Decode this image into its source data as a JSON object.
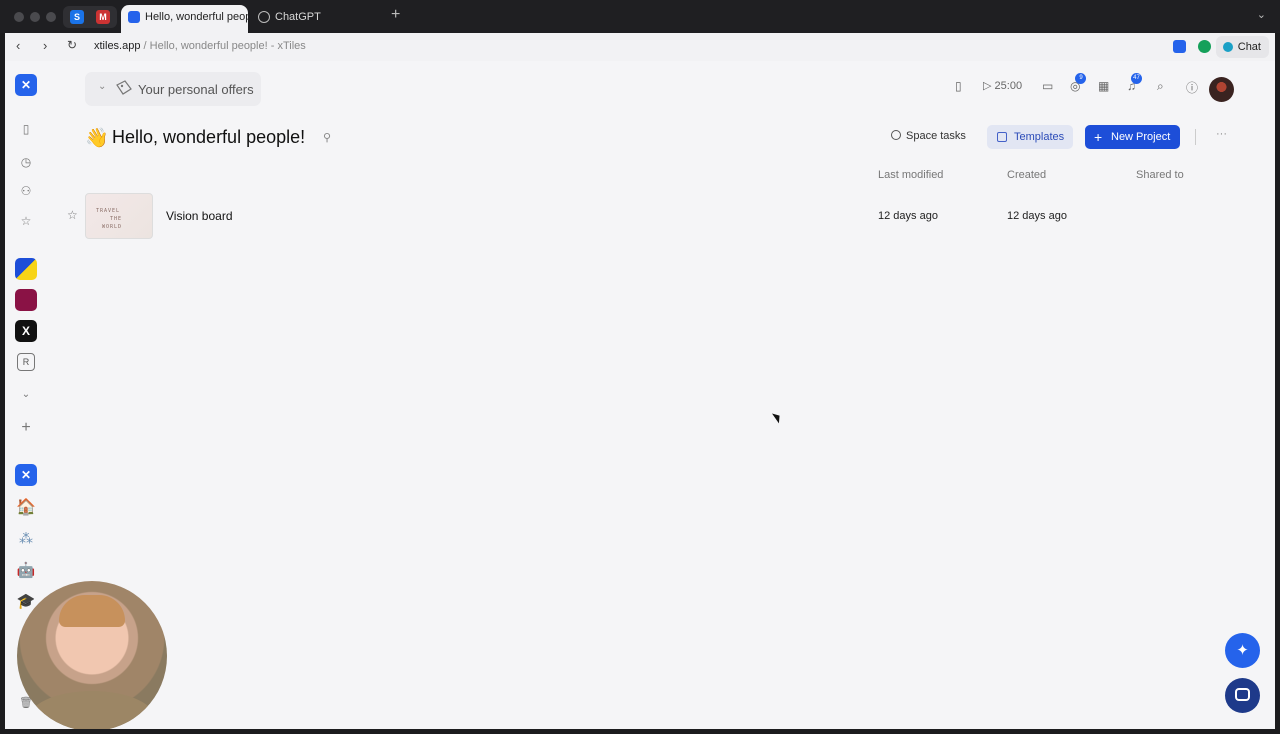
{
  "browser": {
    "tabs": [
      {
        "label": "Hello, wonderful peopl",
        "active": true
      },
      {
        "label": "ChatGPT",
        "active": false
      }
    ],
    "url_host": "xtiles.app",
    "url_rest": " / Hello, wonderful people! - xTiles",
    "chat_label": "Chat"
  },
  "rail": {
    "workspace_letter": "R"
  },
  "header": {
    "offers_label": "Your personal offers",
    "timer": "25:00",
    "tasks_badge": "9",
    "notifications_badge": "47"
  },
  "page": {
    "emoji": "👋",
    "title": "Hello, wonderful people!",
    "space_tasks_label": "Space tasks",
    "templates_label": "Templates",
    "new_project_label": "New Project",
    "more_label": "···"
  },
  "table": {
    "columns": [
      "Last modified",
      "Created",
      "Shared to"
    ],
    "rows": [
      {
        "name": "Vision board",
        "last_modified": "12 days ago",
        "created": "12 days ago",
        "shared_to": ""
      }
    ]
  },
  "thumbnail_text": [
    "TRAVEL",
    "THE",
    "WORLD"
  ],
  "colors": {
    "accent": "#2563eb",
    "templates_bg": "#e2e6f3",
    "page_bg": "#f5f5f7"
  }
}
